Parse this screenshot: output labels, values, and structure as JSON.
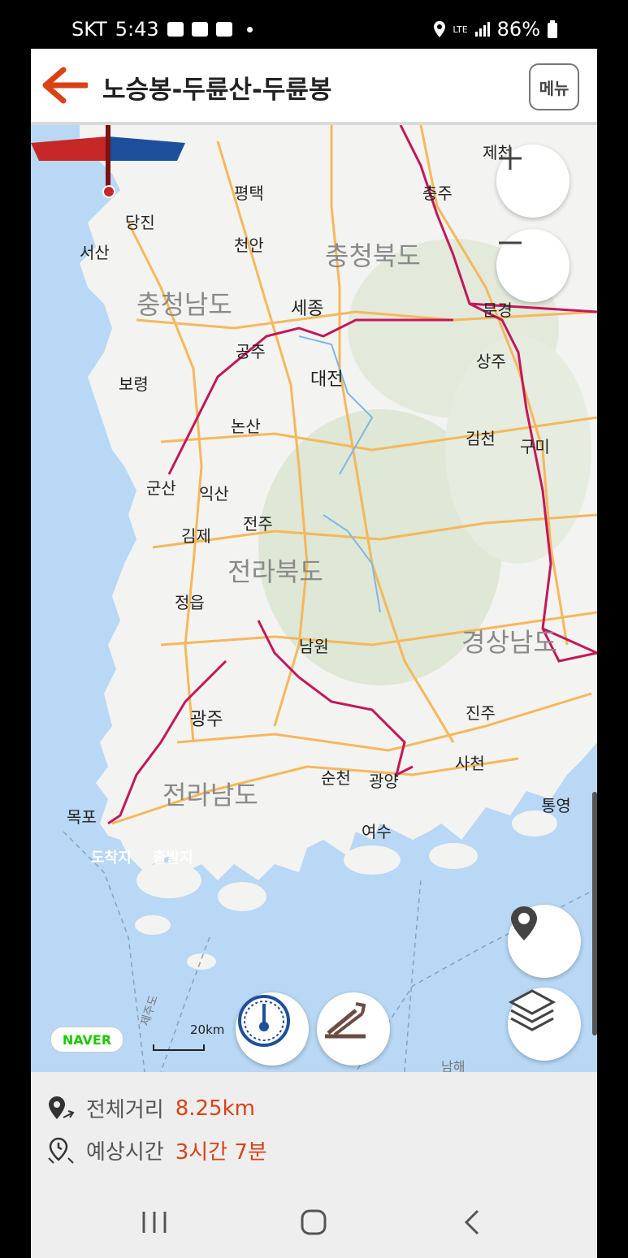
{
  "status_bar": {
    "carrier": "SKT",
    "time": "5:43",
    "network": "LTE",
    "battery": "86%"
  },
  "header": {
    "title": "노승봉-두륜산-두륜봉",
    "menu_label": "메뉴"
  },
  "map": {
    "cities": [
      {
        "name": "제천"
      },
      {
        "name": "평택"
      },
      {
        "name": "충주"
      },
      {
        "name": "당진"
      },
      {
        "name": "서산"
      },
      {
        "name": "천안"
      },
      {
        "name": "문경"
      },
      {
        "name": "세종"
      },
      {
        "name": "공주"
      },
      {
        "name": "상주"
      },
      {
        "name": "보령"
      },
      {
        "name": "대전"
      },
      {
        "name": "논산"
      },
      {
        "name": "김천"
      },
      {
        "name": "구미"
      },
      {
        "name": "군산"
      },
      {
        "name": "익산"
      },
      {
        "name": "김제"
      },
      {
        "name": "전주"
      },
      {
        "name": "정읍"
      },
      {
        "name": "남원"
      },
      {
        "name": "광주"
      },
      {
        "name": "진주"
      },
      {
        "name": "사천"
      },
      {
        "name": "순천"
      },
      {
        "name": "광양"
      },
      {
        "name": "통영"
      },
      {
        "name": "목포"
      },
      {
        "name": "여수"
      }
    ],
    "regions": [
      {
        "name": "충청북도"
      },
      {
        "name": "충청남도"
      },
      {
        "name": "전라북도"
      },
      {
        "name": "경상남도"
      },
      {
        "name": "전라남도"
      }
    ],
    "sea_label": "남해",
    "strait_label": "제주도",
    "naver_logo": "NAVER",
    "scale_label": "20km",
    "flag_end": "도착지",
    "flag_start": "출발지"
  },
  "info": {
    "distance_label": "전체거리",
    "distance_value": "8.25km",
    "time_label": "예상시간",
    "time_value": "3시간 7분"
  },
  "icons": {
    "back": "arrow-left-icon",
    "location": "location-pin-icon",
    "layers": "layers-icon",
    "compass": "compass-icon",
    "elevation": "elevation-icon"
  },
  "colors": {
    "accent": "#d84315",
    "highway": "#f5b85c",
    "rail": "#c2185b",
    "sea": "#b8d8f5"
  }
}
